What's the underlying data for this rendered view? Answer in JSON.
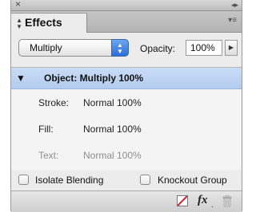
{
  "window": {
    "close_glyph": "×",
    "collapse_glyph": "◂▸"
  },
  "tab": {
    "label": "Effects",
    "icon": "stepper-arrows-icon"
  },
  "panel_menu_icon": "panel-menu-icon",
  "blend": {
    "mode": "Multiply",
    "opacity_label": "Opacity:",
    "opacity_value": "100%"
  },
  "list": {
    "object_row": {
      "label": "Object: Multiply 100%",
      "expanded": true
    },
    "rows": [
      {
        "label": "Stroke:",
        "value": "Normal 100%",
        "dimmed": false
      },
      {
        "label": "Fill:",
        "value": "Normal 100%",
        "dimmed": false
      },
      {
        "label": "Text:",
        "value": "Normal 100%",
        "dimmed": true
      }
    ]
  },
  "options": {
    "isolate_blending": {
      "label": "Isolate Blending",
      "checked": false
    },
    "knockout_group": {
      "label": "Knockout Group",
      "checked": false
    }
  },
  "footer": {
    "icons": [
      "clear-effects-icon",
      "fx-icon",
      "trash-icon"
    ]
  },
  "colors": {
    "selection": "#b3ccef",
    "stepper_blue": "#2a6fd6",
    "clear_red": "#d0202a"
  }
}
